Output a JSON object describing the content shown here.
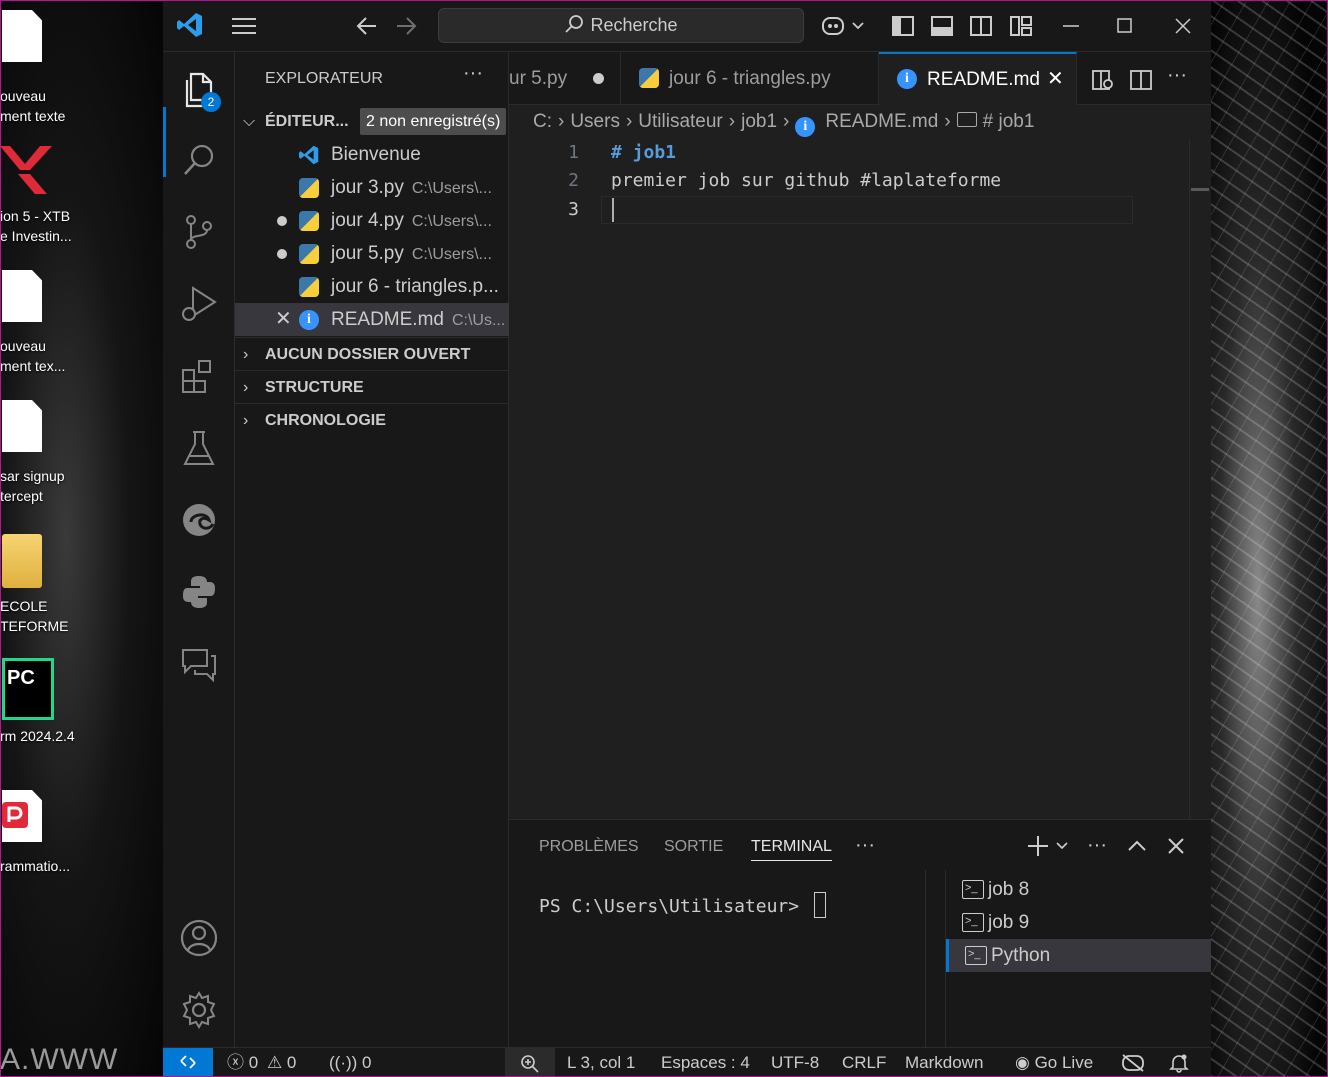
{
  "desktop": {
    "icons": [
      {
        "label1": "ouveau",
        "label2": "ment texte",
        "kind": "doc"
      },
      {
        "label1": "ion 5 - XTB",
        "label2": "e Investin...",
        "kind": "xtb"
      },
      {
        "label1": "ouveau",
        "label2": "ment tex...",
        "kind": "doc"
      },
      {
        "label1": "sar signup",
        "label2": "tercept",
        "kind": "doc"
      },
      {
        "label1": "ECOLE",
        "label2": "TEFORME",
        "kind": "folder"
      },
      {
        "label1": "rm 2024.2.4",
        "label2": "",
        "kind": "pycharm"
      },
      {
        "label1": "rammatio...",
        "label2": "",
        "kind": "pdf"
      }
    ],
    "pycharm_logo_text": "PC",
    "watermark": "A.WWW"
  },
  "titlebar": {
    "search_placeholder": "Recherche"
  },
  "activitybar": {
    "explorer_badge": "2",
    "icons": [
      "files-icon",
      "search-icon",
      "source-control-icon",
      "run-debug-icon",
      "extensions-icon",
      "testing-icon",
      "edge-icon",
      "python-icon",
      "chat-icon",
      "account-icon",
      "settings-gear-icon"
    ]
  },
  "sidebar": {
    "title": "EXPLORATEUR",
    "open_editors": {
      "label": "ÉDITEUR...",
      "badge": "2 non enregistré(s)",
      "items": [
        {
          "name": "Bienvenue",
          "path": "",
          "icon": "vscode-icon",
          "dirty": false,
          "selected": false
        },
        {
          "name": "jour 3.py",
          "path": "C:\\Users\\...",
          "icon": "python-file-icon",
          "dirty": false,
          "selected": false
        },
        {
          "name": "jour 4.py",
          "path": "C:\\Users\\...",
          "icon": "python-file-icon",
          "dirty": true,
          "selected": false
        },
        {
          "name": "jour 5.py",
          "path": "C:\\Users\\...",
          "icon": "python-file-icon",
          "dirty": true,
          "selected": false
        },
        {
          "name": "jour 6 - triangles.p...",
          "path": "",
          "icon": "python-file-icon",
          "dirty": false,
          "selected": false
        },
        {
          "name": "README.md",
          "path": "C:\\Us...",
          "icon": "info-icon",
          "dirty": false,
          "selected": true
        }
      ]
    },
    "sections": [
      "AUCUN DOSSIER OUVERT",
      "STRUCTURE",
      "CHRONOLOGIE"
    ]
  },
  "tabs": [
    {
      "label": "ur 5.py",
      "dirty": true,
      "active": false
    },
    {
      "label": "jour 6 - triangles.py",
      "dirty": false,
      "active": false
    },
    {
      "label": "README.md",
      "dirty": false,
      "active": true
    }
  ],
  "breadcrumb": [
    "C:",
    "Users",
    "Utilisateur",
    "job1",
    "README.md",
    "# job1"
  ],
  "editor": {
    "lines": [
      {
        "num": "1",
        "text": "# job1",
        "heading": true
      },
      {
        "num": "2",
        "text": "premier job sur github #laplateforme",
        "heading": false
      },
      {
        "num": "3",
        "text": "",
        "heading": false
      }
    ]
  },
  "panel": {
    "tabs": [
      "PROBLÈMES",
      "SORTIE",
      "TERMINAL"
    ],
    "active_tab": "TERMINAL",
    "prompt": "PS C:\\Users\\Utilisateur> ",
    "terminals": [
      {
        "name": "job 8",
        "active": false
      },
      {
        "name": "job 9",
        "active": false
      },
      {
        "name": "Python",
        "active": true
      }
    ]
  },
  "statusbar": {
    "errors": "0",
    "warnings": "0",
    "ports": "0",
    "position": "L 3, col 1",
    "spaces": "Espaces : 4",
    "encoding": "UTF-8",
    "eol": "CRLF",
    "language": "Markdown",
    "golive": "Go Live"
  },
  "colors": {
    "accent": "#0078d4",
    "editor_bg": "#1f1f1f",
    "chrome_bg": "#181818",
    "heading": "#569cd6"
  }
}
